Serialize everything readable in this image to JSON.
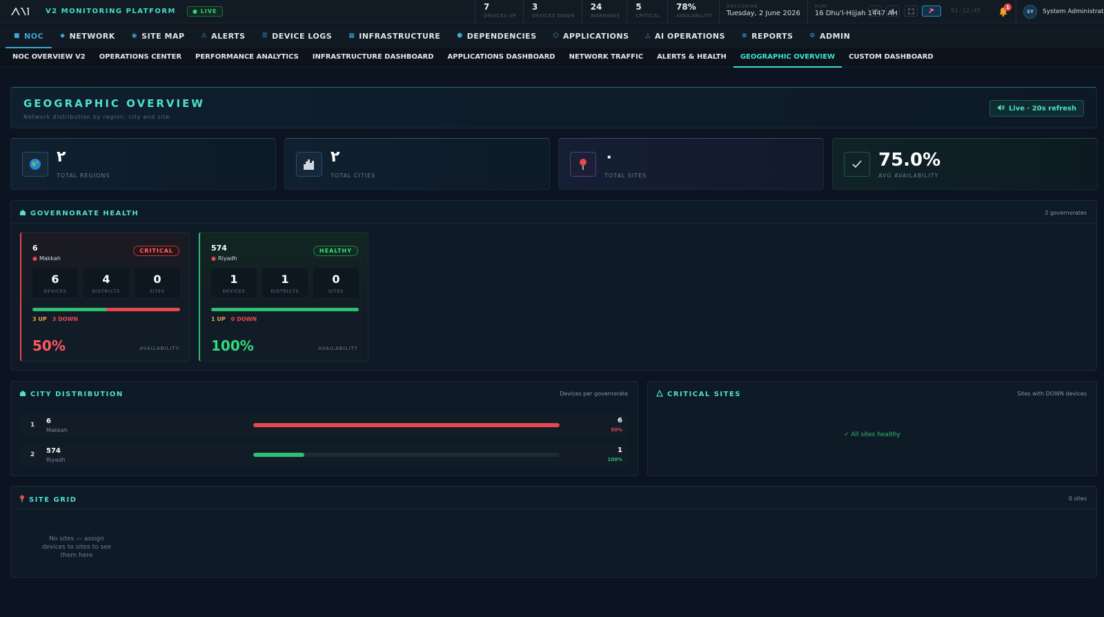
{
  "app": {
    "brand": "V2 MONITORING PLATFORM",
    "live_label": "● LIVE"
  },
  "top_stats": [
    {
      "value": "7",
      "label": "DEVICES UP"
    },
    {
      "value": "3",
      "label": "DEVICES DOWN"
    },
    {
      "value": "24",
      "label": "WARNINGS"
    },
    {
      "value": "5",
      "label": "CRITICAL"
    },
    {
      "value": "78%",
      "label": "AVAILABILITY"
    }
  ],
  "dates": {
    "gregorian_label": "GREGORIAN",
    "gregorian_value": "Tuesday, 2 June 2026",
    "hijri_label": "HIJRI",
    "hijri_value": "16 Dhu'l-Hijjah 1447 AH"
  },
  "toolbar": {
    "lang": "AR",
    "clock": "01:12:45",
    "notifications": "1"
  },
  "user": {
    "initials": "SY",
    "name": "System Administrator"
  },
  "nav": [
    {
      "icon": "■",
      "label": "NOC"
    },
    {
      "icon": "◆",
      "label": "NETWORK"
    },
    {
      "icon": "◉",
      "label": "SITE MAP"
    },
    {
      "icon": "⚠",
      "label": "ALERTS"
    },
    {
      "icon": "☰",
      "label": "DEVICE LOGS"
    },
    {
      "icon": "▦",
      "label": "INFRASTRUCTURE"
    },
    {
      "icon": "⬢",
      "label": "DEPENDENCIES"
    },
    {
      "icon": "⬡",
      "label": "APPLICATIONS"
    },
    {
      "icon": "△",
      "label": "AI OPERATIONS"
    },
    {
      "icon": "≡",
      "label": "REPORTS"
    },
    {
      "icon": "⚙",
      "label": "ADMIN"
    }
  ],
  "subnav": [
    "NOC OVERVIEW V2",
    "OPERATIONS CENTER",
    "PERFORMANCE ANALYTICS",
    "INFRASTRUCTURE DASHBOARD",
    "APPLICATIONS DASHBOARD",
    "NETWORK TRAFFIC",
    "ALERTS & HEALTH",
    "GEOGRAPHIC OVERVIEW",
    "CUSTOM DASHBOARD"
  ],
  "page": {
    "title": "GEOGRAPHIC OVERVIEW",
    "subtitle": "Network distribution by region, city and site",
    "live_button": "Live · 20s refresh"
  },
  "kpis": [
    {
      "value": "٢",
      "label": "TOTAL REGIONS"
    },
    {
      "value": "٢",
      "label": "TOTAL CITIES"
    },
    {
      "value": "٠",
      "label": "TOTAL SITES"
    },
    {
      "value": "75.0%",
      "label": "AVG AVAILABILITY"
    }
  ],
  "governorate": {
    "title": "GOVERNORATE HEALTH",
    "meta": "2 governorates",
    "cards": [
      {
        "name": "6",
        "city": "Makkah",
        "status": "CRITICAL",
        "devices": "6",
        "districts": "4",
        "sites": "0",
        "devices_label": "DEVICES",
        "districts_label": "DISTRICTS",
        "sites_label": "SITES",
        "up": "3 UP",
        "down": "3 DOWN",
        "up_fraction": 0.5,
        "availability": "50%",
        "availability_label": "AVAILABILITY"
      },
      {
        "name": "574",
        "city": "Riyadh",
        "status": "HEALTHY",
        "devices": "1",
        "districts": "1",
        "sites": "0",
        "devices_label": "DEVICES",
        "districts_label": "DISTRICTS",
        "sites_label": "SITES",
        "up": "1 UP",
        "down": "0 DOWN",
        "up_fraction": 1.0,
        "availability": "100%",
        "availability_label": "AVAILABILITY"
      }
    ]
  },
  "city_distribution": {
    "title": "CITY DISTRIBUTION",
    "meta": "Devices per governorate",
    "rows": [
      {
        "rank": "1",
        "name": "6",
        "city": "Makkah",
        "count": "6",
        "pct": "50%",
        "fill": 1.0,
        "color": "#e5484d"
      },
      {
        "rank": "2",
        "name": "574",
        "city": "Riyadh",
        "count": "1",
        "pct": "100%",
        "fill": 0.167,
        "color": "#2fbf71"
      }
    ]
  },
  "critical_sites": {
    "title": "CRITICAL SITES",
    "meta": "Sites with DOWN devices",
    "message": "✓ All sites healthy"
  },
  "site_grid": {
    "title": "SITE GRID",
    "meta": "0 sites",
    "message": "No sites — assign devices to sites to see them here"
  },
  "colors": {
    "accent": "#4fe0d0",
    "critical": "#e5484d",
    "healthy": "#2fbf71"
  }
}
